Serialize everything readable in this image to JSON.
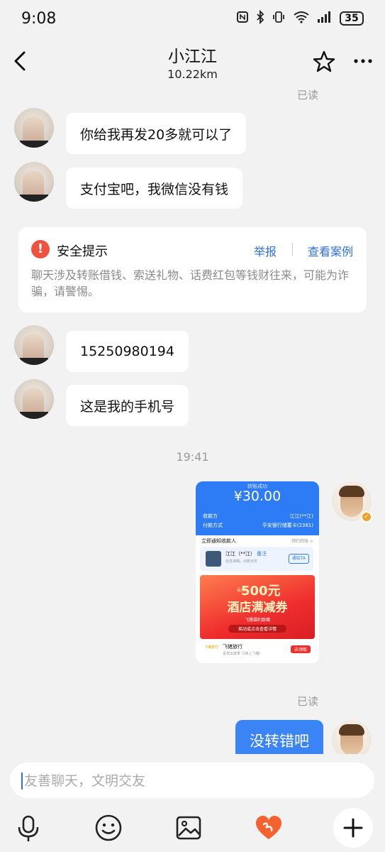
{
  "status_bar": {
    "time": "9:08",
    "battery": "35"
  },
  "header": {
    "title": "小江江",
    "distance": "10.22km"
  },
  "read_receipts": {
    "top": "已读",
    "bottom": "已读"
  },
  "messages_incoming": [
    {
      "text": "你给我再发20多就可以了"
    },
    {
      "text": "支付宝吧，我微信没有钱"
    },
    {
      "text": "15250980194"
    },
    {
      "text": "这是我的手机号"
    }
  ],
  "safety_notice": {
    "title": "安全提示",
    "report_label": "举报",
    "cases_label": "查看案例",
    "body": "聊天涉及转账借钱、索送礼物、话费红包等钱财往来，可能为诈骗，请警惕。"
  },
  "timestamp": "19:41",
  "payment_screenshot": {
    "status": "转账成功",
    "amount": "¥30.00",
    "payee_label": "收款方",
    "payee_value": "江江(**江)",
    "method_label": "付款方式",
    "method_value": "平安银行储蓄卡(2381)",
    "notify_title": "立即通知收款人",
    "notify_right": "预约转账 >",
    "contact_name": "江江（**江）",
    "contact_tag": "备注",
    "contact_sub": "信息准确，对账无忧",
    "notify_button": "通知TA",
    "ad_tag": "最高",
    "ad_amount": "500元",
    "ad_title": "酒店满减券",
    "ad_line1": "飞猪福利致赠",
    "ad_line2": "摇动或点击查看详情",
    "foot_logo": "飞猪旅行",
    "foot_name": "飞猪旅行",
    "foot_sub": "喜享出游季 订房上飞猪!",
    "foot_button": "去领取"
  },
  "messages_outgoing": [
    {
      "text": "没转错吧"
    }
  ],
  "input": {
    "placeholder": "友善聊天，文明交友",
    "value": ""
  },
  "colors": {
    "accent_blue": "#3b84f5",
    "link_blue": "#2f6fd6",
    "warning_red": "#ef5340",
    "background": "#f2f2f2",
    "heart_orange": "#f5612f"
  },
  "icons": {
    "back": "back-arrow-icon",
    "favorite": "star-icon",
    "more": "more-dots-icon",
    "voice": "microphone-icon",
    "emoji": "emoji-icon",
    "image": "image-icon",
    "gift": "heart-icon",
    "plus": "plus-icon"
  }
}
